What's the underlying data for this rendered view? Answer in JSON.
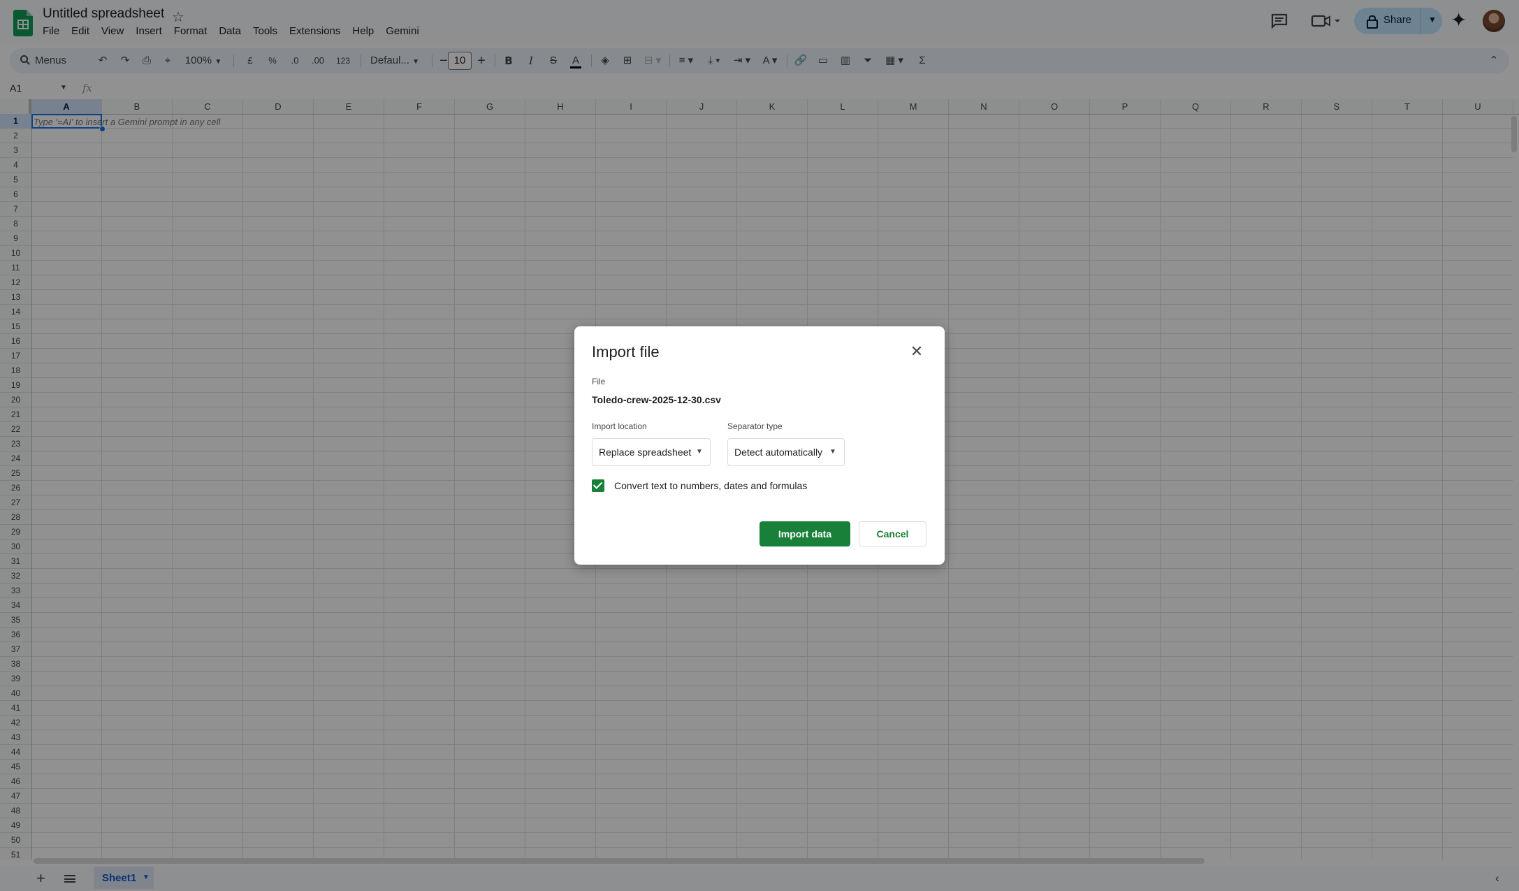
{
  "header": {
    "doc_title": "Untitled spreadsheet",
    "menu": [
      "File",
      "Edit",
      "View",
      "Insert",
      "Format",
      "Data",
      "Tools",
      "Extensions",
      "Help",
      "Gemini"
    ],
    "share_label": "Share"
  },
  "toolbar": {
    "search_label": "Menus",
    "zoom": "100%",
    "currency": "£",
    "percent": "%",
    "decrease_decimal": ".0",
    "increase_decimal": ".00",
    "number_format": "123",
    "font": "Defaul...",
    "font_size": "10"
  },
  "formula_bar": {
    "cell_ref": "A1",
    "fx": "fx"
  },
  "grid": {
    "columns": [
      "A",
      "B",
      "C",
      "D",
      "E",
      "F",
      "G",
      "H",
      "I",
      "J",
      "K",
      "L",
      "M",
      "N",
      "O",
      "P",
      "Q",
      "R",
      "S",
      "T",
      "U"
    ],
    "selected_column": "A",
    "rows": [
      "1",
      "2",
      "3",
      "4",
      "5",
      "6",
      "7",
      "8",
      "9",
      "10",
      "11",
      "12",
      "13",
      "14",
      "15",
      "16",
      "17",
      "18",
      "19",
      "20",
      "21",
      "22",
      "23",
      "24",
      "25",
      "26",
      "27",
      "28",
      "29",
      "30",
      "31",
      "32",
      "33",
      "34",
      "35",
      "36",
      "37",
      "38",
      "39",
      "40",
      "41",
      "42",
      "43",
      "44",
      "45",
      "46",
      "47",
      "48",
      "49",
      "50",
      "51"
    ],
    "selected_row": "1",
    "cell_hint": "Type '=AI' to insert a Gemini prompt in any cell"
  },
  "bottom": {
    "sheet_name": "Sheet1"
  },
  "dialog": {
    "title": "Import file",
    "file_label": "File",
    "file_name": "Toledo-crew-2025-12-30.csv",
    "import_location_label": "Import location",
    "import_location_value": "Replace spreadsheet",
    "separator_label": "Separator type",
    "separator_value": "Detect automatically",
    "convert_label": "Convert text to numbers, dates and formulas",
    "convert_checked": true,
    "import_button": "Import data",
    "cancel_button": "Cancel"
  },
  "colors": {
    "brand_green": "#188038",
    "sheets_green": "#0f9d58",
    "selection_blue": "#1a73e8",
    "share_bg": "#c2e7ff"
  }
}
